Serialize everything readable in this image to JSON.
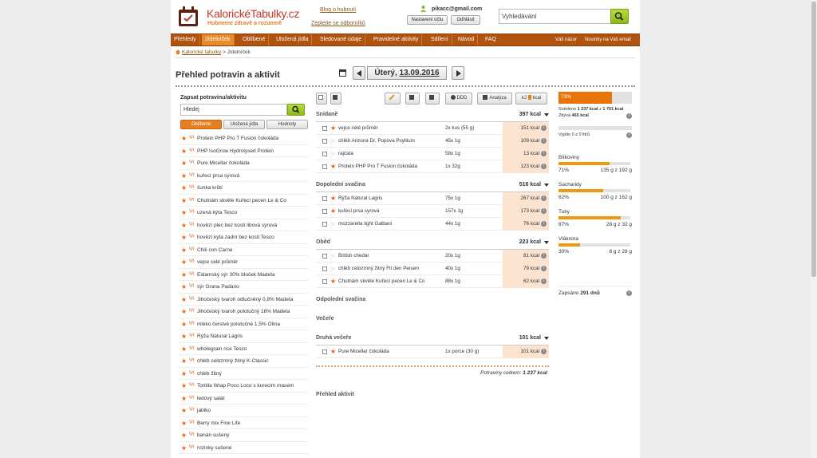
{
  "header": {
    "logo_title": "KalorickéTabulky.cz",
    "logo_subtitle": "Hubneme zdravě a rozumně",
    "blog_link": "Blog o hubnutí",
    "expert_link": "Zeptejte se odborníků",
    "user_email": "pikacc@gmail.com",
    "settings_button": "Nastavení účtu",
    "logout_button": "Odhlásit",
    "search_placeholder": "Vyhledávání"
  },
  "nav": {
    "items": [
      "Přehledy",
      "Jídelníček",
      "Oblíbené",
      "Uložená jídla",
      "Sledované údaje",
      "Pravidelné aktivity",
      "Sdílení",
      "Návod",
      "FAQ"
    ],
    "active": "Jídelníček",
    "right_items": [
      "Váš názor",
      "Novinky na Váš email"
    ]
  },
  "breadcrumb": {
    "home": "Kalorické tabulky",
    "separator": ">",
    "current": "Jídelníček"
  },
  "page_title": "Přehled potravin a aktivit",
  "date": {
    "weekday": "Úterý,",
    "date": "13.09.2016"
  },
  "left_panel": {
    "label": "Zapsat potravinu/aktivitu",
    "search_value": "Hledej",
    "tabs": [
      "Oblíbené",
      "Uložená jídla",
      "Hodnoty"
    ],
    "active_tab": "Oblíbené",
    "foods": [
      "Protein PHP Pro T Fusion čokoláda",
      "PHP IsoGrow Hydrolysed Protein",
      "Pure Micellar čokoláda",
      "kuřecí prsa syrová",
      "šunka krůtí",
      "Chutnám skvěle Kuřecí pecen Le & Co",
      "uzená kýta Tesco",
      "hovězí plec bez kosti libová syrová",
      "hovězí kýta zadní bez kosti Tesco",
      "Chili con Carne",
      "vejce celé průměr",
      "Eidamský sýr 30% bloček Madeta",
      "sýr Grana Padano",
      "Jihočeský tvaroh odtučněný 0,8% Madeta",
      "Jihočeský tvaroh polotučný 18% Madeta",
      "mléko čerstvé polotučné 1,5% Olma",
      "Rýža Natural Lagris",
      "wholegrain rice Tesco",
      "chléb celozrnný žitný K-Classic",
      "chléb žitný",
      "Tortilla Wrap Poco Loco s kurecim masem",
      "ledový salát",
      "jablko",
      "Berry mix Fine Life",
      "banán sušený",
      "rozinky sušené"
    ]
  },
  "toolbar": {
    "ddd": "DDD",
    "analyza": "Analýza",
    "units": "kJ",
    "units2": "kcal"
  },
  "meals": [
    {
      "name": "Snídaně",
      "kcal": "397 kcal",
      "items": [
        {
          "name": "vejce celé průměr",
          "amount": "2x kus (55 g)",
          "kcal": "151 kcal",
          "fav": true
        },
        {
          "name": "chléb Arizona Dr. Popova Psyllium",
          "amount": "45x 1g",
          "kcal": "109 kcal",
          "fav": false
        },
        {
          "name": "rajčata",
          "amount": "58x 1g",
          "kcal": "13 kcal",
          "fav": false
        },
        {
          "name": "Protein PHP Pro T Fusion čokoláda",
          "amount": "1x 32g",
          "kcal": "123 kcal",
          "fav": true
        }
      ]
    },
    {
      "name": "Dopolední svačina",
      "kcal": "516 kcal",
      "items": [
        {
          "name": "Rýža Natural Lagris",
          "amount": "75x 1g",
          "kcal": "267 kcal",
          "fav": true
        },
        {
          "name": "kuřecí prsa syrová",
          "amount": "157x 1g",
          "kcal": "173 kcal",
          "fav": true
        },
        {
          "name": "mozzarella light Galbani",
          "amount": "44x 1g",
          "kcal": "76 kcal",
          "fav": false
        }
      ]
    },
    {
      "name": "Oběd",
      "kcal": "223 kcal",
      "items": [
        {
          "name": "British chedar",
          "amount": "20x 1g",
          "kcal": "81 kcal",
          "fav": false
        },
        {
          "name": "chléb celozrnný žitný Fit den Penam",
          "amount": "40x 1g",
          "kcal": "79 kcal",
          "fav": false
        },
        {
          "name": "Chutnám skvěle Kuřecí pecen Le & Co",
          "amount": "88x 1g",
          "kcal": "62 kcal",
          "fav": true
        }
      ]
    },
    {
      "name": "Odpolední svačina",
      "kcal": "",
      "items": []
    },
    {
      "name": "Večeře",
      "kcal": "",
      "items": []
    },
    {
      "name": "Druhá večeře",
      "kcal": "101 kcal",
      "items": [
        {
          "name": "Pure Micellar čokoláda",
          "amount": "1x porce (30 g)",
          "kcal": "101 kcal",
          "fav": true
        }
      ]
    }
  ],
  "total": {
    "label": "Potraviny celkem:",
    "value": "1 237 kcal"
  },
  "activities_title": "Přehled aktivit",
  "summary": {
    "percent": "73%",
    "percent_value": 0.73,
    "eaten_label": "Snědeno",
    "eaten": "1 237 kcal",
    "of": "z",
    "goal": "1 701 kcal",
    "remaining_label": "Zbývá",
    "remaining": "465 kcal",
    "drink_label": "Vypito",
    "drink": "0 z 0 litrů",
    "drink_value": 0,
    "nutrients": [
      {
        "name": "Bílkoviny",
        "percent": "71%",
        "value": "135 g z 192 g",
        "fraction": 0.71
      },
      {
        "name": "Sacharidy",
        "percent": "62%",
        "value": "100 g z 162 g",
        "fraction": 0.62
      },
      {
        "name": "Tuky",
        "percent": "87%",
        "value": "28 g z 32 g",
        "fraction": 0.87
      },
      {
        "name": "Vláknina",
        "percent": "30%",
        "value": "8 g z 28 g",
        "fraction": 0.3
      }
    ],
    "written_label": "Zapsáno",
    "written": "291 dnů"
  },
  "colors": {
    "nav": "#b0530f",
    "nav_active": "#ea8b2a",
    "accent": "#e67e22",
    "bar": "#ef9a0e",
    "search_green": "#9cc722",
    "kcal_bg": "#fbe3d0"
  }
}
